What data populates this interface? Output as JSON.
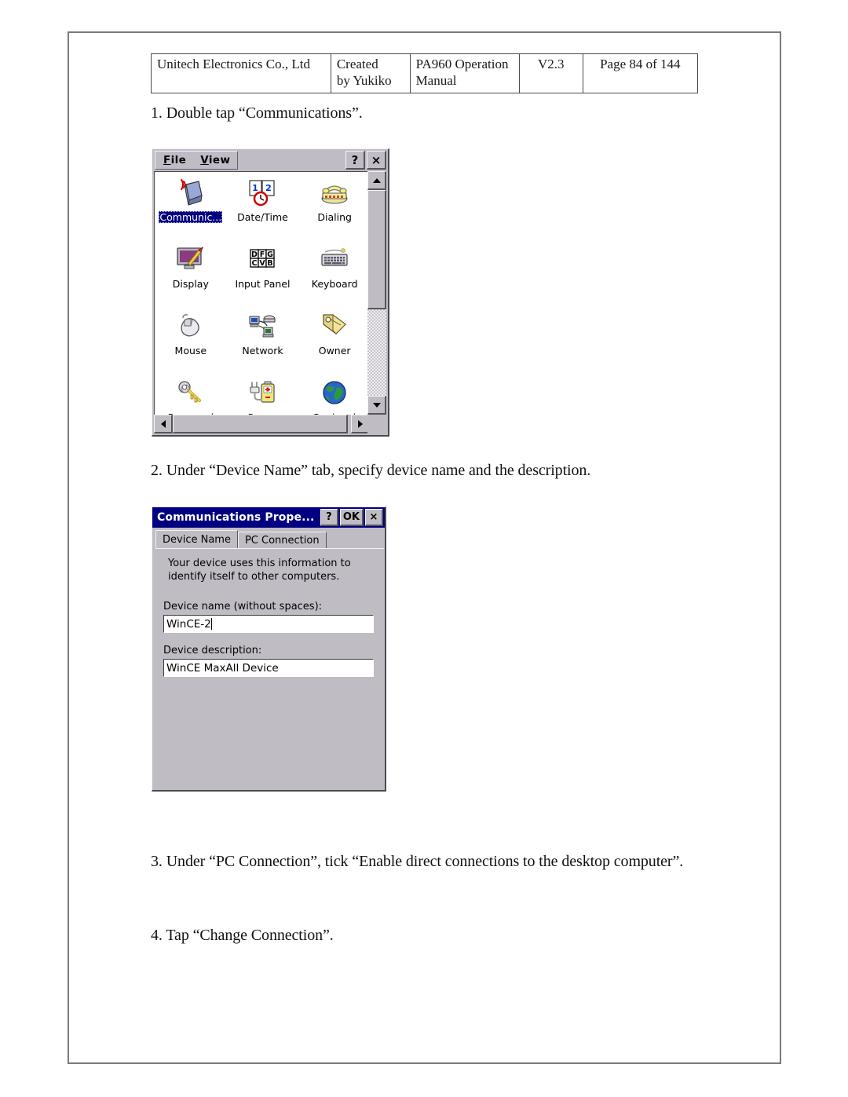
{
  "header": {
    "company": "Unitech Electronics Co., Ltd",
    "created_by": "Created by Yukiko",
    "created_line1": "Created",
    "created_line2": "by Yukiko",
    "product_line1": "PA960 Operation",
    "product_line2": "Manual",
    "version": "V2.3",
    "page": "Page 84 of 144"
  },
  "steps": {
    "step1": "1. Double tap “Communications”.",
    "step2": "2. Under “Device Name” tab, specify device name and the description.",
    "step3": "3. Under “PC Connection”, tick “Enable direct connections to the desktop computer”.",
    "step4": "4. Tap “Change Connection”."
  },
  "control_panel": {
    "menu": {
      "file": "File",
      "view": "View",
      "help_label": "?",
      "close_label": "×"
    },
    "icons": [
      {
        "label": "Communic...",
        "icon": "communications-icon",
        "selected": true
      },
      {
        "label": "Date/Time",
        "icon": "date-time-icon",
        "selected": false
      },
      {
        "label": "Dialing",
        "icon": "dialing-icon",
        "selected": false
      },
      {
        "label": "Display",
        "icon": "display-icon",
        "selected": false
      },
      {
        "label": "Input Panel",
        "icon": "input-panel-icon",
        "selected": false
      },
      {
        "label": "Keyboard",
        "icon": "keyboard-icon",
        "selected": false
      },
      {
        "label": "Mouse",
        "icon": "mouse-icon",
        "selected": false
      },
      {
        "label": "Network",
        "icon": "network-icon",
        "selected": false
      },
      {
        "label": "Owner",
        "icon": "owner-icon",
        "selected": false
      },
      {
        "label": "Password",
        "icon": "password-icon",
        "selected": false
      },
      {
        "label": "Power",
        "icon": "power-icon",
        "selected": false
      },
      {
        "label": "Regional",
        "icon": "regional-icon",
        "selected": false
      }
    ]
  },
  "dialog": {
    "title": "Communications Prope...",
    "help_label": "?",
    "ok_label": "OK",
    "close_label": "×",
    "tabs": [
      {
        "label": "Device Name",
        "active": true
      },
      {
        "label": "PC Connection",
        "active": false
      }
    ],
    "help_text": "Your device uses this information to identify itself to other computers.",
    "device_name_label": "Device name (without spaces):",
    "device_name_value": "WinCE-2",
    "device_description_label": "Device description:",
    "device_description_value": "WinCE MaxAll Device"
  },
  "colors": {
    "titlebar": "#000080",
    "window_face": "#c0bcc4",
    "selection": "#000080",
    "page_border": "#7a7a7a"
  }
}
